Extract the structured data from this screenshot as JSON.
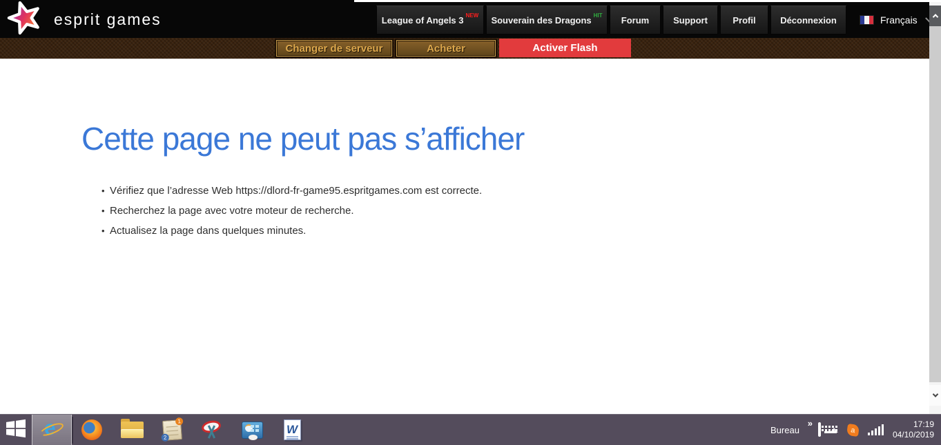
{
  "header": {
    "brand": "esprit games",
    "nav": [
      {
        "label": "League of Angels 3",
        "badge": "NEW"
      },
      {
        "label": "Souverain des Dragons",
        "badge": "HIT"
      },
      {
        "label": "Forum",
        "badge": ""
      },
      {
        "label": "Support",
        "badge": ""
      },
      {
        "label": "Profil",
        "badge": ""
      },
      {
        "label": "Déconnexion",
        "badge": ""
      }
    ],
    "language": {
      "label": "Français",
      "flag": "france-flag"
    }
  },
  "toolbar": {
    "change_server_label": "Changer de serveur",
    "buy_label": "Acheter",
    "activate_flash_label": "Activer Flash"
  },
  "error_page": {
    "title": "Cette page ne peut pas s’afficher",
    "bullets": [
      "Vérifiez que l’adresse Web https://dlord-fr-game95.espritgames.com est correcte.",
      "Recherchez la page avec votre moteur de recherche.",
      "Actualisez la page dans quelques minutes."
    ],
    "bullet_char": "•"
  },
  "taskbar": {
    "apps": [
      {
        "name": "start"
      },
      {
        "name": "internet-explorer",
        "state": "active"
      },
      {
        "name": "firefox"
      },
      {
        "name": "file-explorer"
      },
      {
        "name": "windows-journal"
      },
      {
        "name": "snipping-tool"
      },
      {
        "name": "control-panel"
      },
      {
        "name": "word"
      }
    ],
    "tray": {
      "desktop_label": "Bureau",
      "overflow_chevron": "»",
      "journal_badges": {
        "one": "1",
        "two": "2"
      },
      "avast_letter": "a",
      "time": "17:19",
      "date": "04/10/2019"
    }
  },
  "colors": {
    "title_blue": "#3b78d7",
    "badge_new": "#ff1e1e",
    "badge_hit": "#2fae3f",
    "flash_red": "#e23b3d",
    "gold_text": "#dca74c",
    "toolbar_brown": "#39220e",
    "taskbar_bg": "#544c5c"
  }
}
